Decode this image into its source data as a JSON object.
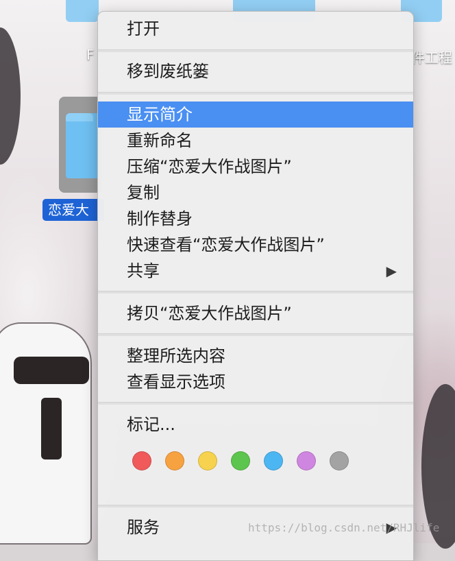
{
  "desktop": {
    "bg_label_left": "F",
    "bg_label_right": "件工程",
    "selected_file_label": "恋爱大"
  },
  "menu": {
    "items": [
      {
        "label": "打开"
      },
      {
        "label": "移到废纸篓"
      },
      {
        "label": "显示简介",
        "selected": true
      },
      {
        "label": "重新命名"
      },
      {
        "label": "压缩“恋爱大作战图片”"
      },
      {
        "label": "复制"
      },
      {
        "label": "制作替身"
      },
      {
        "label": "快速查看“恋爱大作战图片”"
      },
      {
        "label": "共享",
        "submenu_arrow": "▶"
      },
      {
        "label": "拷贝“恋爱大作战图片”"
      },
      {
        "label": "整理所选内容"
      },
      {
        "label": "查看显示选项"
      },
      {
        "label": "标记..."
      },
      {
        "label": "服务",
        "submenu_arrow": "▶"
      }
    ],
    "tag_colors": [
      {
        "name": "red",
        "hex": "#f05a5a"
      },
      {
        "name": "orange",
        "hex": "#f7a240"
      },
      {
        "name": "yellow",
        "hex": "#f6d24e"
      },
      {
        "name": "green",
        "hex": "#5cc54d"
      },
      {
        "name": "blue",
        "hex": "#4cb6f2"
      },
      {
        "name": "purple",
        "hex": "#cf86e0"
      },
      {
        "name": "gray",
        "hex": "#a3a3a3"
      }
    ],
    "selection_color": "#4a8ff2"
  },
  "watermark": "https://blog.csdn.net/RHJlife"
}
